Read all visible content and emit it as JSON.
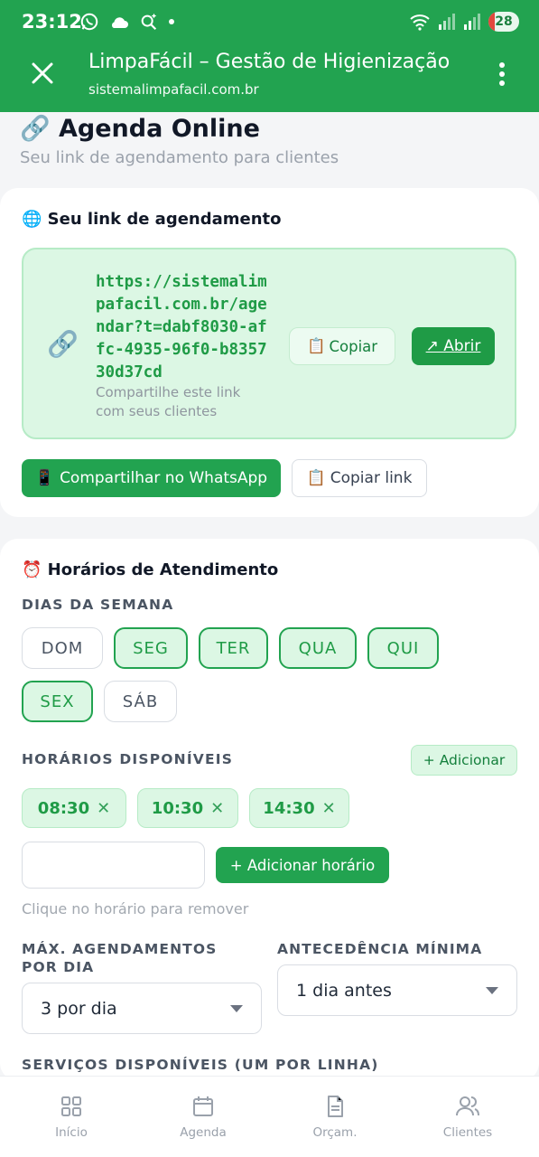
{
  "status_bar": {
    "time": "23:12",
    "battery": "28"
  },
  "browser": {
    "title": "LimpaFácil – Gestão de Higienização",
    "url": "sistemalimpafacil.com.br"
  },
  "page": {
    "title": "🔗 Agenda Online",
    "subtitle": "Seu link de agendamento para clientes"
  },
  "link_card": {
    "title": "🌐 Seu link de agendamento",
    "link_icon": "🔗",
    "link": "https://sistemalimpafacil.com.br/agendar?t=dabf8030-affc-4935-96f0-b835730d37cd",
    "hint": "Compartilhe este link com seus clientes",
    "copy_icon": "📋",
    "copy_label": "Copiar",
    "open_label": "↗ Abrir",
    "whatsapp_icon": "📱",
    "whatsapp_label": "Compartilhar no WhatsApp",
    "copy_link_label": "Copiar link"
  },
  "schedule_card": {
    "title": "⏰ Horários de Atendimento",
    "days_label": "DIAS DA SEMANA",
    "days": [
      {
        "label": "DOM",
        "active": false
      },
      {
        "label": "SEG",
        "active": true
      },
      {
        "label": "TER",
        "active": true
      },
      {
        "label": "QUA",
        "active": true
      },
      {
        "label": "QUI",
        "active": true
      },
      {
        "label": "SEX",
        "active": true
      },
      {
        "label": "SÁB",
        "active": false
      }
    ],
    "times_label": "HORÁRIOS DISPONÍVEIS",
    "add_label": "+ Adicionar",
    "times": [
      "08:30",
      "10:30",
      "14:30"
    ],
    "remove_glyph": "✕",
    "time_input_value": "",
    "add_time_label": "+ Adicionar horário",
    "times_hint": "Clique no horário para remover",
    "max_label": "MÁX. AGENDAMENTOS POR DIA",
    "max_value": "3 por dia",
    "advance_label": "ANTECEDÊNCIA MÍNIMA",
    "advance_value": "1 dia antes",
    "services_label": "SERVIÇOS DISPONÍVEIS (UM POR LINHA)"
  },
  "bottom_nav": [
    {
      "label": "Início",
      "icon": "grid-icon"
    },
    {
      "label": "Agenda",
      "icon": "calendar-icon"
    },
    {
      "label": "Orçam.",
      "icon": "document-icon"
    },
    {
      "label": "Clientes",
      "icon": "users-icon"
    }
  ]
}
